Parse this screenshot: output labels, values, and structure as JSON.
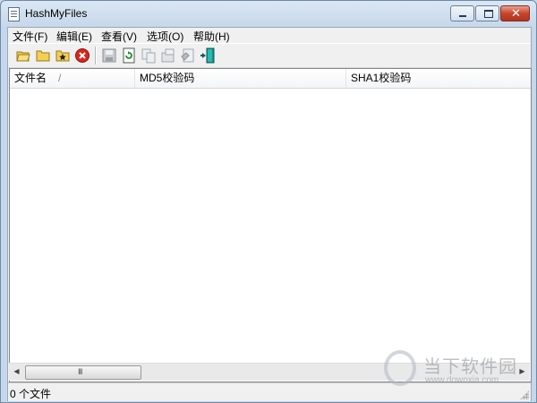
{
  "window": {
    "title": "HashMyFiles"
  },
  "menu": [
    {
      "label": "文件(F)"
    },
    {
      "label": "编辑(E)"
    },
    {
      "label": "查看(V)"
    },
    {
      "label": "选项(O)"
    },
    {
      "label": "帮助(H)"
    }
  ],
  "toolbar": {
    "icons": [
      "open-folder-icon",
      "folder-icon",
      "add-folder-icon",
      "delete-icon",
      "save-icon",
      "refresh-icon",
      "copy-icon",
      "properties-icon",
      "html-report-icon",
      "exit-icon"
    ]
  },
  "list": {
    "columns": [
      "文件名",
      "MD5校验码",
      "SHA1校验码"
    ],
    "sort_indicator": "/",
    "rows": []
  },
  "scrollbar": {
    "left_arrow": "◀",
    "right_arrow": "▶",
    "grip": "III"
  },
  "status": {
    "text": "0 个文件"
  },
  "watermark": {
    "text": "当下软件园",
    "url": "www.downxia.com"
  },
  "colors": {
    "close_button": "#c5452b",
    "window_frame": "#c5d7ea",
    "delete_red": "#d9261c",
    "exit_teal": "#1a8f8a"
  }
}
